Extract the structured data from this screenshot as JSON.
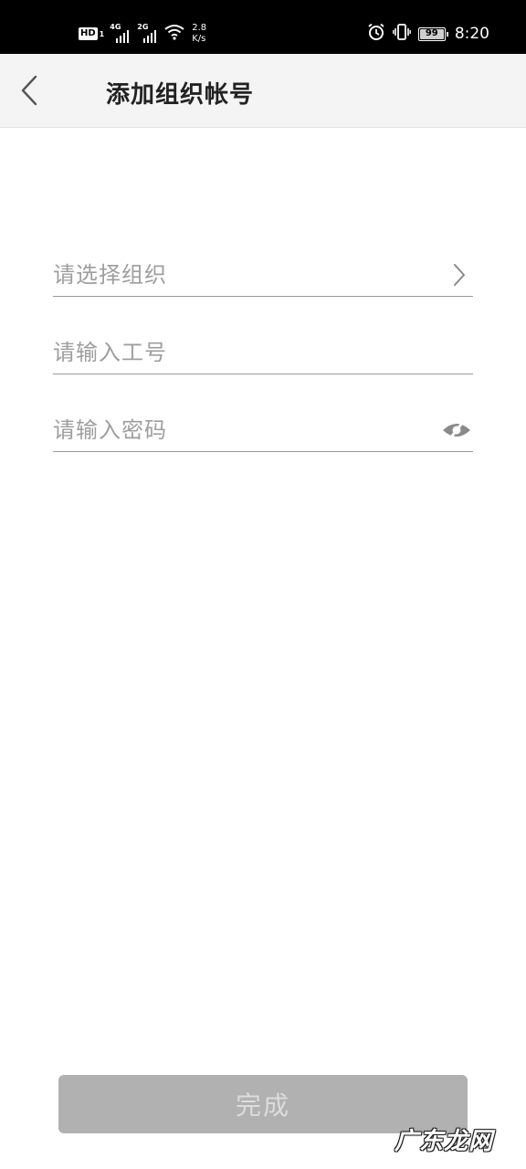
{
  "status_bar": {
    "hd_label": "HD",
    "hd_sub": "1",
    "signal1_gen": "4G",
    "signal2_gen": "2G",
    "speed_value": "2.8",
    "speed_unit": "K/s",
    "battery": "99",
    "time": "8:20",
    "icons": [
      "alarm-icon",
      "vibrate-icon",
      "battery-icon",
      "wifi-icon"
    ]
  },
  "header": {
    "title": "添加组织帐号",
    "back_icon": "chevron-left-icon"
  },
  "form": {
    "org_placeholder": "请选择组织",
    "employee_id_placeholder": "请输入工号",
    "password_placeholder": "请输入密码",
    "password_toggle_icon": "eye-hidden-icon",
    "org_chevron_icon": "chevron-right-icon"
  },
  "footer": {
    "done_label": "完成",
    "done_enabled": false
  },
  "watermark": "广东龙网",
  "colors": {
    "status_bar_bg": "#000000",
    "header_bg": "#f4f4f4",
    "placeholder": "#9e9e9e",
    "button_bg": "#b1b1b1",
    "button_text": "#dcdcdc"
  }
}
